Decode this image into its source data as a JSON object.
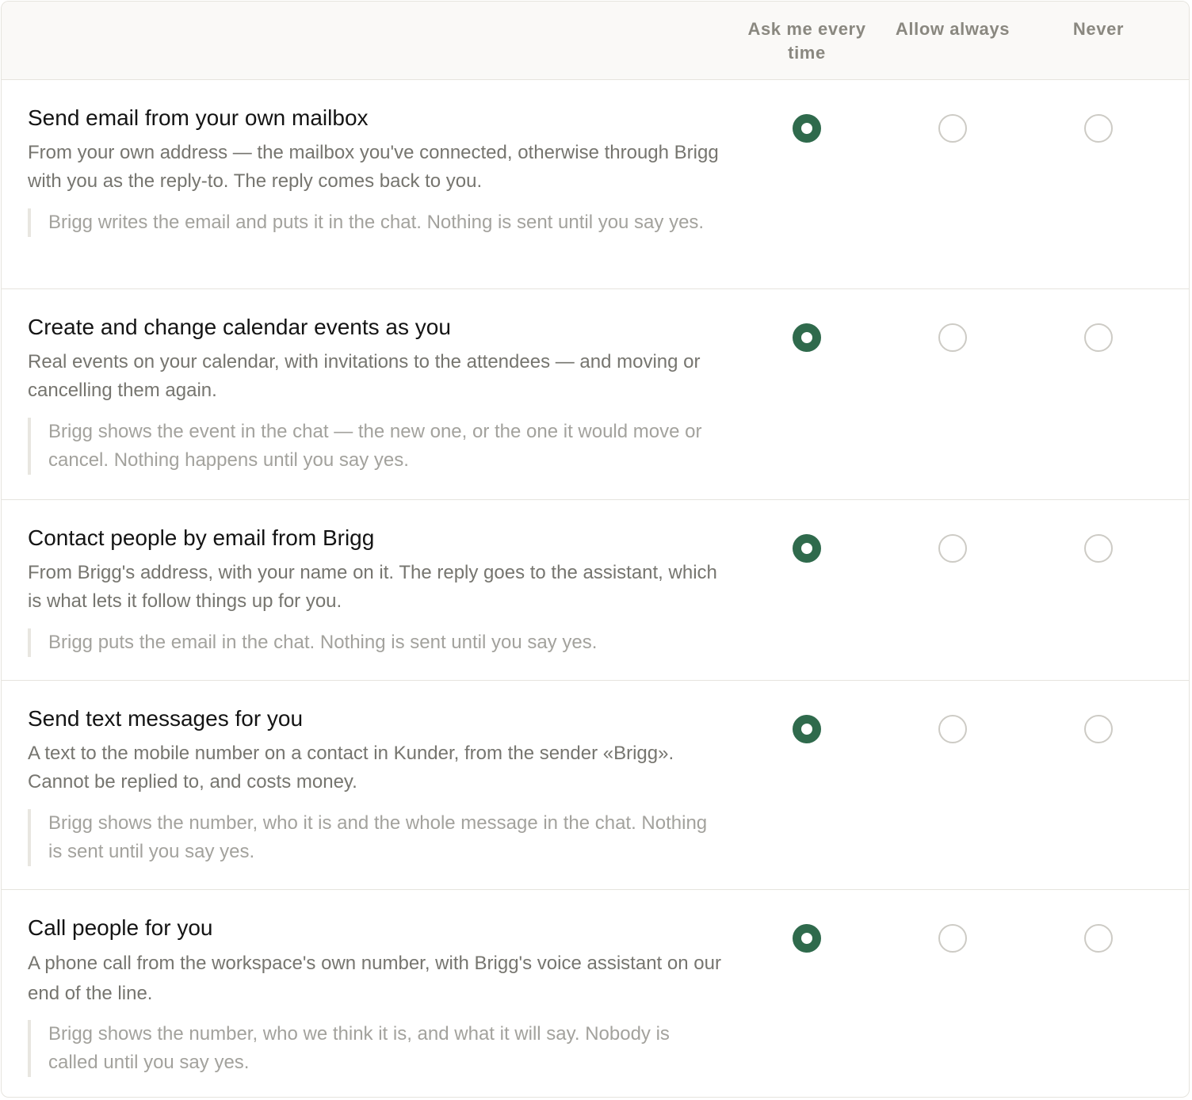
{
  "columns": {
    "ask": "Ask me every time",
    "allow": "Allow always",
    "never": "Never"
  },
  "accent_color": "#2f6a4c",
  "permissions": [
    {
      "title": "Send email from your own mailbox",
      "description": "From your own address — the mailbox you've connected, otherwise through Brigg with you as the reply-to. The reply comes back to you.",
      "note": "Brigg writes the email and puts it in the chat. Nothing is sent until you say yes.",
      "selected": "Ask me every time"
    },
    {
      "title": "Create and change calendar events as you",
      "description": "Real events on your calendar, with invitations to the attendees — and moving or cancelling them again.",
      "note": "Brigg shows the event in the chat — the new one, or the one it would move or cancel. Nothing happens until you say yes.",
      "selected": "Ask me every time"
    },
    {
      "title": "Contact people by email from Brigg",
      "description": "From Brigg's address, with your name on it. The reply goes to the assistant, which is what lets it follow things up for you.",
      "note": "Brigg puts the email in the chat. Nothing is sent until you say yes.",
      "selected": "Ask me every time"
    },
    {
      "title": "Send text messages for you",
      "description": "A text to the mobile number on a contact in Kunder, from the sender «Brigg». Cannot be replied to, and costs money.",
      "note": "Brigg shows the number, who it is and the whole message in the chat. Nothing is sent until you say yes.",
      "selected": "Ask me every time"
    },
    {
      "title": "Call people for you",
      "description": "A phone call from the workspace's own number, with Brigg's voice assistant on our end of the line.",
      "note": "Brigg shows the number, who we think it is, and what it will say. Nobody is called until you say yes.",
      "selected": "Ask me every time"
    }
  ]
}
